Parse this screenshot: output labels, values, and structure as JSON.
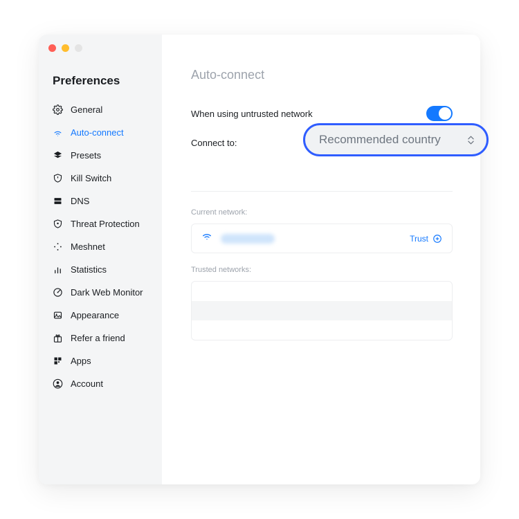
{
  "sidebar": {
    "title": "Preferences",
    "items": [
      {
        "label": "General"
      },
      {
        "label": "Auto-connect"
      },
      {
        "label": "Presets"
      },
      {
        "label": "Kill Switch"
      },
      {
        "label": "DNS"
      },
      {
        "label": "Threat Protection"
      },
      {
        "label": "Meshnet"
      },
      {
        "label": "Statistics"
      },
      {
        "label": "Dark Web Monitor"
      },
      {
        "label": "Appearance"
      },
      {
        "label": "Refer a friend"
      },
      {
        "label": "Apps"
      },
      {
        "label": "Account"
      }
    ]
  },
  "main": {
    "title": "Auto-connect",
    "untrusted_label": "When using untrusted network",
    "untrusted_on": true,
    "connect_to_label": "Connect to:",
    "dropdown_value": "Recommended country",
    "current_network_label": "Current network:",
    "trust_label": "Trust",
    "trusted_networks_label": "Trusted networks:"
  }
}
